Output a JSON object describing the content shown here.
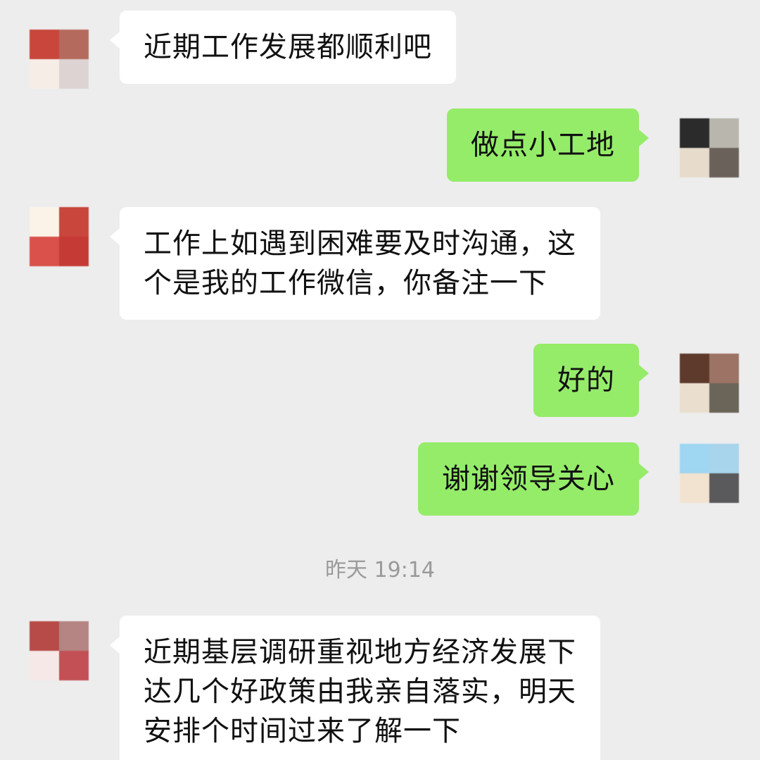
{
  "messages": [
    {
      "side": "in",
      "text": "近期工作发展都顺利吧"
    },
    {
      "side": "out",
      "text": "做点小工地"
    },
    {
      "side": "in",
      "text": "工作上如遇到困难要及时沟通，这\n个是我的工作微信，你备注一下"
    },
    {
      "side": "out",
      "text": "好的"
    },
    {
      "side": "out",
      "text": "谢谢领导关心"
    },
    {
      "side": "in",
      "text": "近期基层调研重视地方经济发展下\n达几个好政策由我亲自落实，明天\n安排个时间过来了解一下"
    }
  ],
  "timestamp": "昨天 19:14",
  "colors": {
    "background": "#ededed",
    "incoming_bubble": "#ffffff",
    "outgoing_bubble": "#95ec69",
    "timestamp_text": "#9a9a9a"
  }
}
